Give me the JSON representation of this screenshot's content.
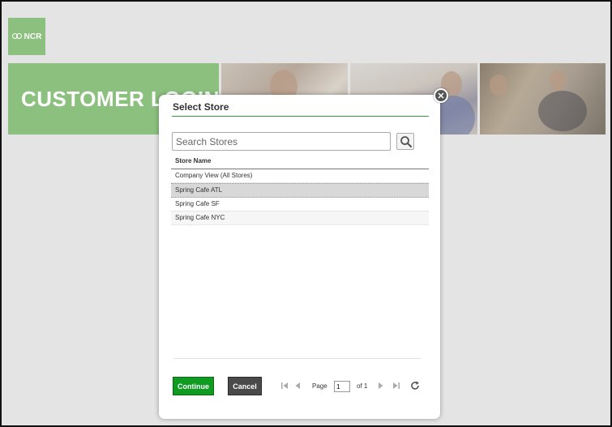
{
  "brand": {
    "logo_text": "NCR"
  },
  "banner": {
    "title": "CUSTOMER LOGIN"
  },
  "dialog": {
    "title": "Select Store",
    "close_symbol": "✕",
    "search": {
      "placeholder": "Search Stores",
      "value": ""
    },
    "table": {
      "column_header": "Store Name",
      "rows": [
        {
          "name": "Company View (All Stores)",
          "selected": false
        },
        {
          "name": "Spring Cafe ATL",
          "selected": true
        },
        {
          "name": "Spring Cafe SF",
          "selected": false
        },
        {
          "name": "Spring Cafe NYC",
          "selected": false
        }
      ]
    },
    "buttons": {
      "continue_label": "Continue",
      "cancel_label": "Cancel"
    },
    "pager": {
      "page_label": "Page",
      "page_value": "1",
      "of_label": "of 1"
    }
  },
  "colors": {
    "accent_green": "#8cc07e",
    "continue_green": "#0f9a20",
    "cancel_gray": "#4a4a4a"
  }
}
